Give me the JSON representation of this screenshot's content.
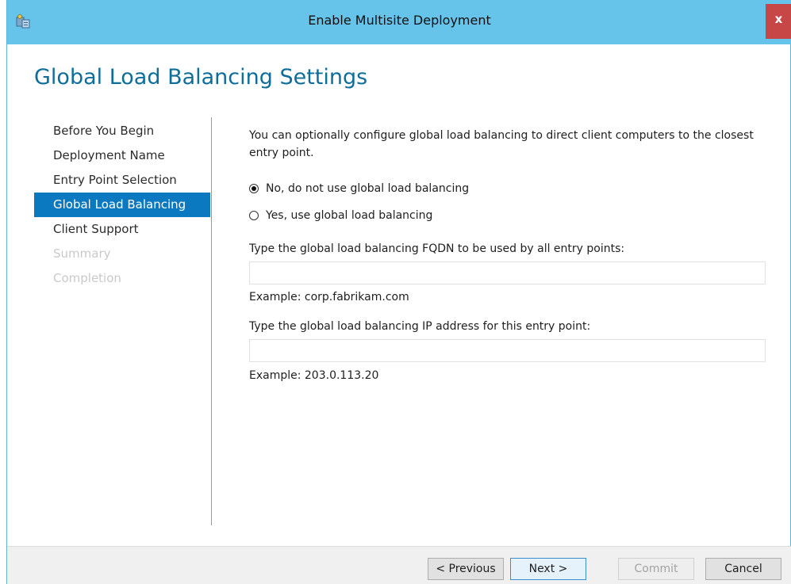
{
  "window": {
    "title": "Enable Multisite Deployment",
    "close_label": "x"
  },
  "page": {
    "heading": "Global Load Balancing Settings"
  },
  "nav": {
    "items": [
      {
        "label": "Before You Begin",
        "state": "normal"
      },
      {
        "label": "Deployment Name",
        "state": "normal"
      },
      {
        "label": "Entry Point Selection",
        "state": "normal"
      },
      {
        "label": "Global Load Balancing",
        "state": "selected"
      },
      {
        "label": "Client Support",
        "state": "normal"
      },
      {
        "label": "Summary",
        "state": "disabled"
      },
      {
        "label": "Completion",
        "state": "disabled"
      }
    ]
  },
  "content": {
    "description": "You can optionally configure global load balancing to direct client computers to the closest entry point.",
    "radio_no": {
      "label": "No, do not use global load balancing",
      "checked": true
    },
    "radio_yes": {
      "label": "Yes, use global load balancing",
      "checked": false
    },
    "fqdn_label": "Type the global load balancing FQDN to be used by all entry points:",
    "fqdn_value": "",
    "fqdn_example": "Example: corp.fabrikam.com",
    "ip_label": "Type the global load balancing IP address for this entry point:",
    "ip_value": "",
    "ip_example": "Example: 203.0.113.20"
  },
  "footer": {
    "previous": "< Previous",
    "next": "Next >",
    "commit": "Commit",
    "cancel": "Cancel"
  },
  "colors": {
    "titlebar": "#66c3ea",
    "heading": "#0e6e99",
    "selected_nav": "#0a79c0",
    "close": "#c74747"
  },
  "icons": {
    "title_icon": "server-wizard-icon"
  }
}
